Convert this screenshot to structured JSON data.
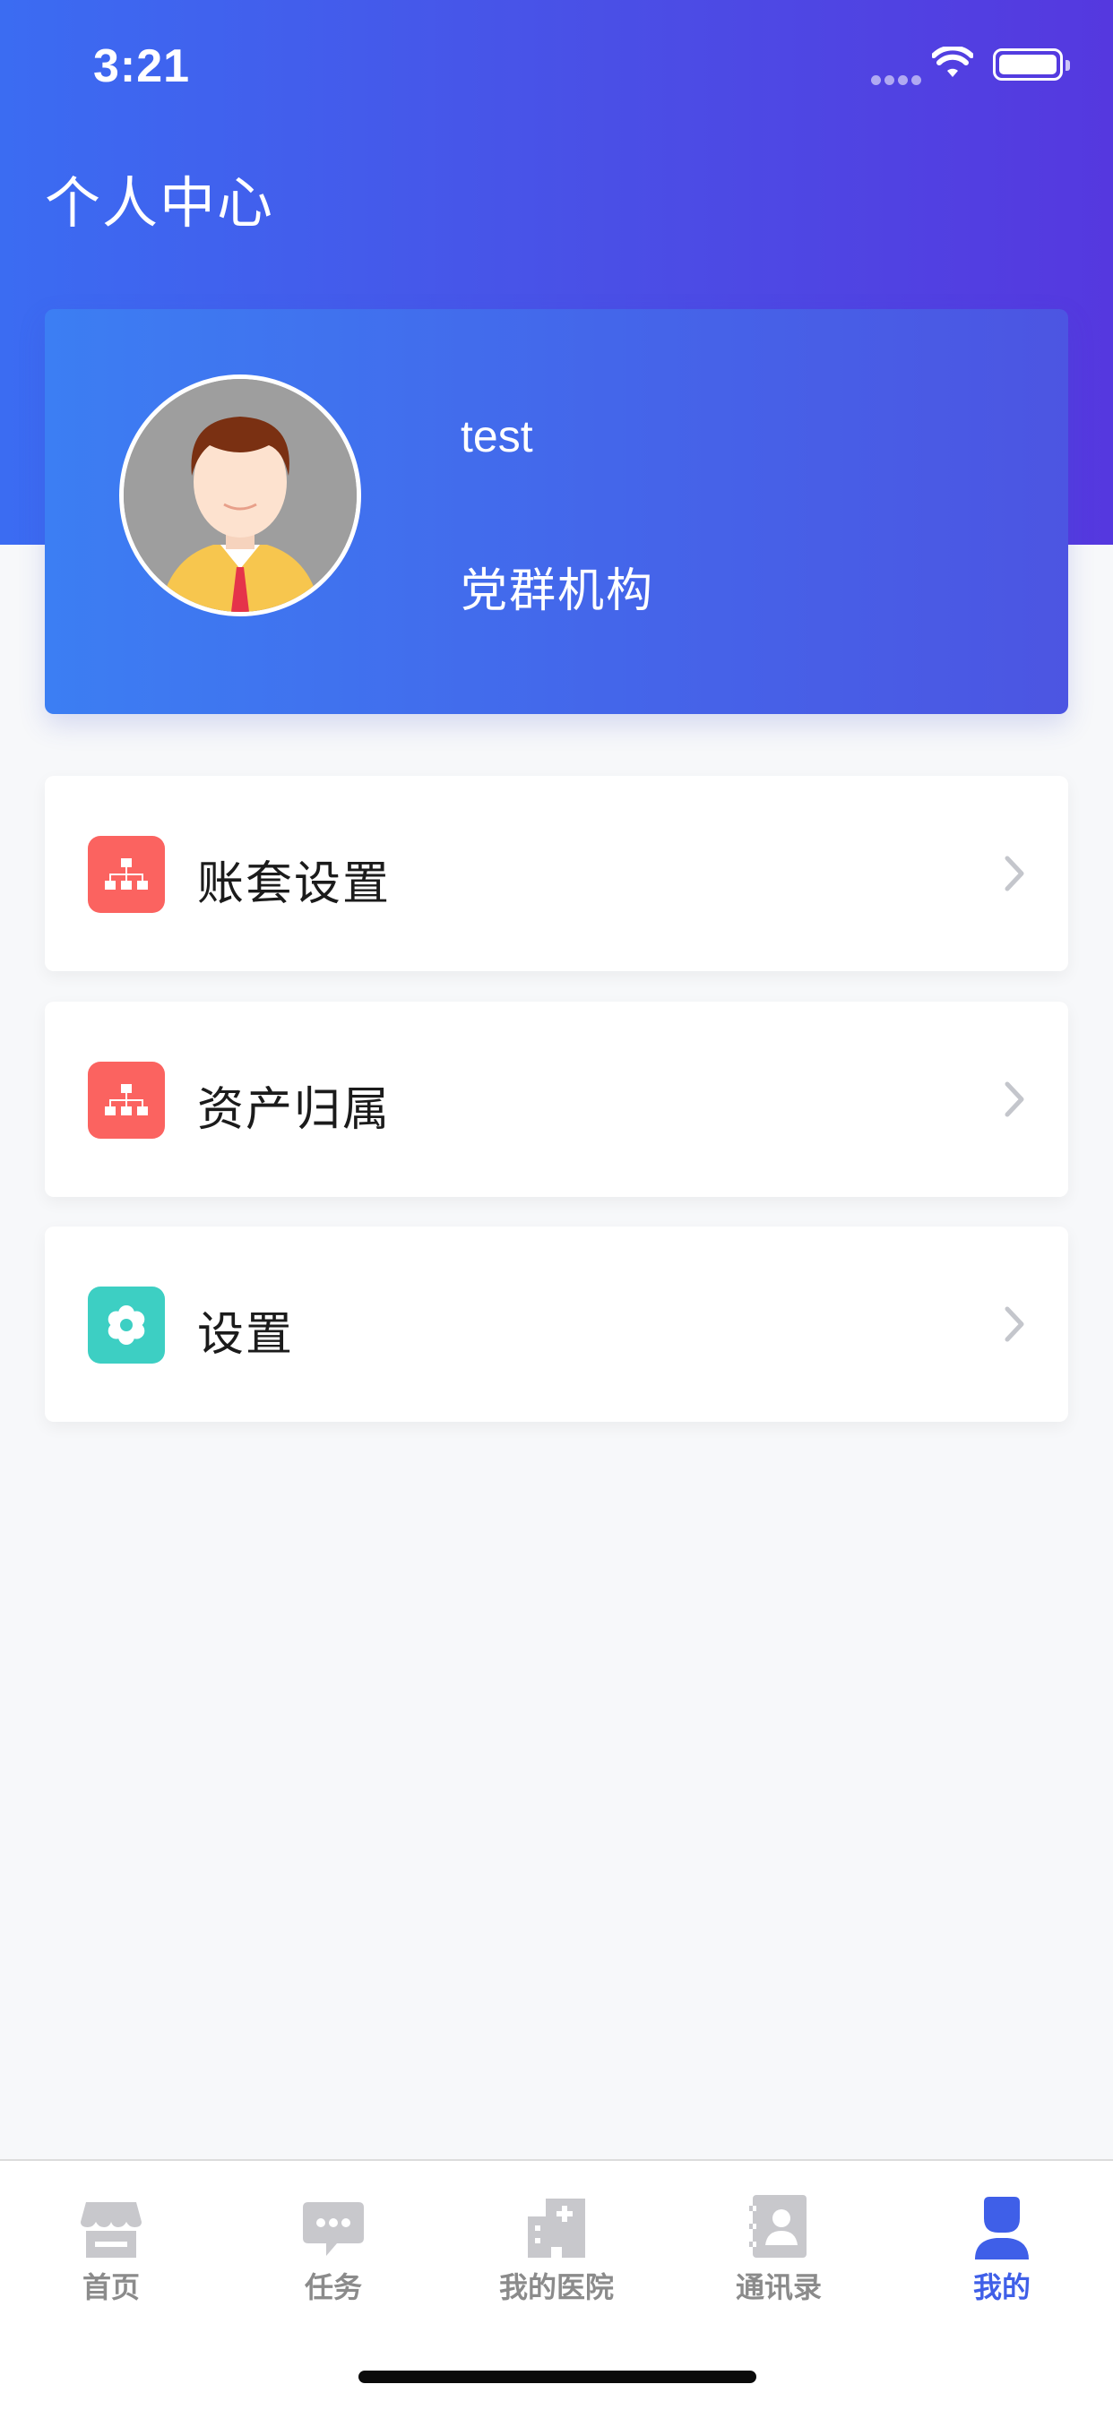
{
  "status_bar": {
    "time": "3:21"
  },
  "header": {
    "title": "个人中心"
  },
  "profile": {
    "username": "test",
    "organization": "党群机构"
  },
  "menu": {
    "items": [
      {
        "label": "账套设置",
        "icon": "org-chart-icon",
        "color": "#fb6360"
      },
      {
        "label": "资产归属",
        "icon": "org-chart-icon",
        "color": "#fb6360"
      },
      {
        "label": "设置",
        "icon": "gear-icon",
        "color": "#3dcfc3"
      }
    ]
  },
  "tabs": [
    {
      "label": "首页",
      "icon": "store-icon"
    },
    {
      "label": "任务",
      "icon": "chat-icon"
    },
    {
      "label": "我的医院",
      "icon": "hospital-icon"
    },
    {
      "label": "通讯录",
      "icon": "contacts-icon"
    },
    {
      "label": "我的",
      "icon": "user-icon",
      "active": true
    }
  ],
  "colors": {
    "accent": "#3f5fe8",
    "inactive": "#8b8b8b",
    "header_start": "#3b6cf2",
    "header_end": "#5538df"
  }
}
